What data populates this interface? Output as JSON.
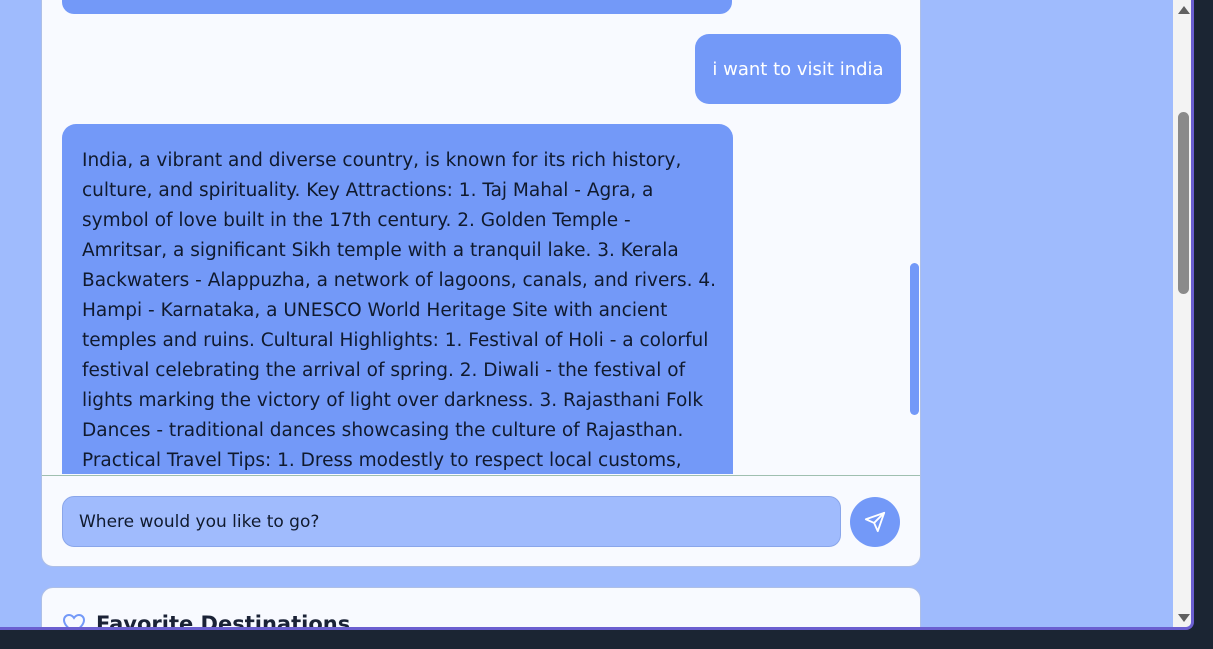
{
  "chat": {
    "user_message": "i want to visit india",
    "assistant_message": "India, a vibrant and diverse country, is known for its rich history, culture, and spirituality. Key Attractions: 1. Taj Mahal - Agra, a symbol of love built in the 17th century. 2. Golden Temple - Amritsar, a significant Sikh temple with a tranquil lake. 3. Kerala Backwaters - Alappuzha, a network of lagoons, canals, and rivers. 4. Hampi - Karnataka, a UNESCO World Heritage Site with ancient temples and ruins. Cultural Highlights: 1. Festival of Holi - a colorful festival celebrating the arrival of spring. 2. Diwali - the festival of lights marking the victory of light over darkness. 3. Rajasthani Folk Dances - traditional dances showcasing the culture of Rajasthan. Practical Travel Tips: 1. Dress modestly to respect local customs, especially when visiting"
  },
  "composer": {
    "value": "Where would you like to go?",
    "send_icon": "send-icon"
  },
  "favorites": {
    "title": "Favorite Destinations",
    "icon": "heart-icon"
  },
  "colors": {
    "bubble": "#7399f8",
    "background": "#9fbbfd",
    "card": "#f8faff"
  }
}
